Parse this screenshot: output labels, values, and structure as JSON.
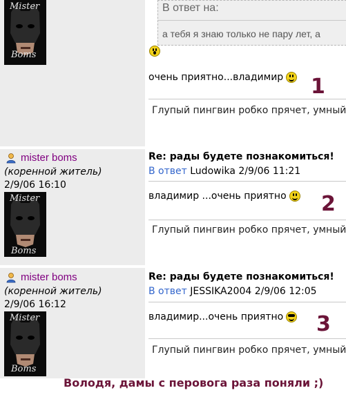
{
  "top_quote": {
    "header": "В ответ на:",
    "text": "а тебя я знаю только не пару лет, а"
  },
  "posts": [
    {
      "avatar_top": "Mister",
      "avatar_bottom": "Boms",
      "message": "очень приятно...владимир",
      "signature": "Глупый пингвин робко прячет, умный",
      "number": "1"
    },
    {
      "username": "mister boms",
      "rank": "(коренной житель)",
      "date": "2/9/06 16:10",
      "avatar_top": "Mister",
      "avatar_bottom": "Boms",
      "subject": "Re: рады будете познакомиться!",
      "reply_label": "В ответ",
      "reply_to": "Ludowika 2/9/06 11:21",
      "message": "владимир ...очень приятно",
      "signature": "Глупый пингвин робко прячет, умный",
      "number": "2"
    },
    {
      "username": "mister boms",
      "rank": "(коренной житель)",
      "date": "2/9/06 16:12",
      "avatar_top": "Mister",
      "avatar_bottom": "Boms",
      "subject": "Re: рады будете познакомиться!",
      "reply_label": "В ответ",
      "reply_to": "JESSIKA2004 2/9/06 12:05",
      "message": "владимир...очень приятно",
      "signature": "Глупый пингвин робко прячет, умный",
      "number": "3"
    }
  ],
  "annotation": "Володя, дамы с перовога раза поняли ;)"
}
